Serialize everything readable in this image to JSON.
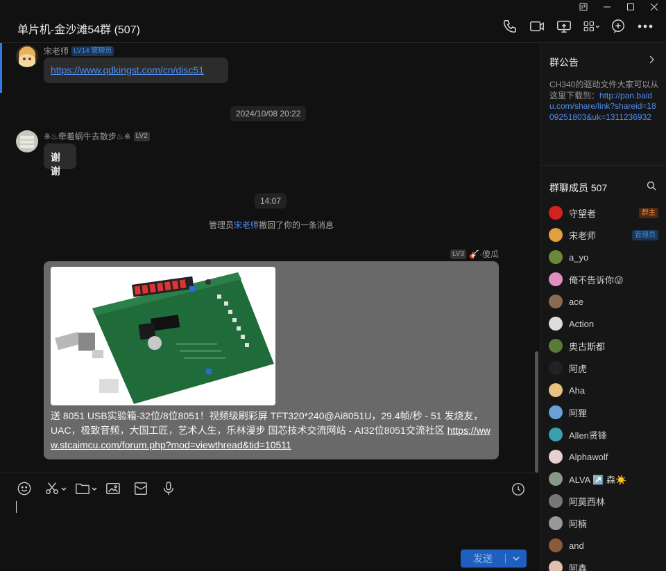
{
  "window": {
    "controls": [
      "pin-icon",
      "minimize-icon",
      "maximize-icon",
      "close-icon"
    ]
  },
  "header": {
    "title": "单片机-金沙滩54群 (507)",
    "tools": [
      "phone-icon",
      "video-icon",
      "screen-share-icon",
      "apps-icon",
      "add-icon",
      "more-icon"
    ]
  },
  "chat": {
    "messages": [
      {
        "sender": "宋老师",
        "level": "LV14 管理员",
        "text": "https://www.qdkingst.com/cn/disc51"
      },
      {
        "timestamp": "2024/10/08 20:22"
      },
      {
        "sender": "※♨牵着蜗牛去散步♨※",
        "level": "LV2",
        "text": "谢谢"
      },
      {
        "timestamp": "14:07"
      },
      {
        "system_prefix": "管理员",
        "system_name": "宋老师",
        "system_suffix": "撤回了你的一条消息"
      },
      {
        "sender": "🎸·傻瓜",
        "level": "LV3",
        "text": "送 8051 USB实验箱-32位/8位8051！视频级刷彩屏 TFT320*240@Ai8051U，29.4帧/秒 - 51 发烧友，UAC，极致音频，大国工匠，艺术人生，乐林漫步 国芯技术交流网站 - AI32位8051交流社区 ",
        "link": "https://www.stcaimcu.com/forum.php?mod=viewthread&tid=10511"
      }
    ]
  },
  "composer": {
    "tools": [
      "emoji-icon",
      "scissors-icon",
      "folder-icon",
      "image-icon",
      "red-packet-icon",
      "microphone-icon"
    ],
    "send_label": "发送"
  },
  "sidebar": {
    "notice_title": "群公告",
    "notice_text": "CH340的驱动文件大家可以从这里下载到：",
    "notice_link": "http://pan.baidu.com/share/link?shareid=1809251803&uk=1311236932",
    "members_title": "群聊成员 507",
    "members": [
      {
        "name": "守望者",
        "role": "群主",
        "color": "#d72020"
      },
      {
        "name": "宋老师",
        "role": "管理员",
        "color": "#e0a040"
      },
      {
        "name": "a_yo",
        "color": "#6a8a3a"
      },
      {
        "name": "俺不告诉你😜",
        "color": "#e090c0"
      },
      {
        "name": "ace",
        "color": "#8a6a50"
      },
      {
        "name": "Action",
        "color": "#dddddd"
      },
      {
        "name": "奥古斯都",
        "color": "#5a7a3a"
      },
      {
        "name": "阿虎",
        "color": "#222222"
      },
      {
        "name": "Aha",
        "color": "#e8c080"
      },
      {
        "name": "阿狸",
        "color": "#6aa0d8"
      },
      {
        "name": "Allen贤锋",
        "color": "#3aa0b0"
      },
      {
        "name": "Alphawolf",
        "color": "#e8d0d0"
      },
      {
        "name": "ALVA ↗️ 森☀️",
        "color": "#889988"
      },
      {
        "name": "阿莫西林",
        "color": "#777777"
      },
      {
        "name": "阿楠",
        "color": "#999999"
      },
      {
        "name": "and",
        "color": "#8a5a3a"
      },
      {
        "name": "阿鑫",
        "color": "#e0c0b0"
      }
    ]
  }
}
